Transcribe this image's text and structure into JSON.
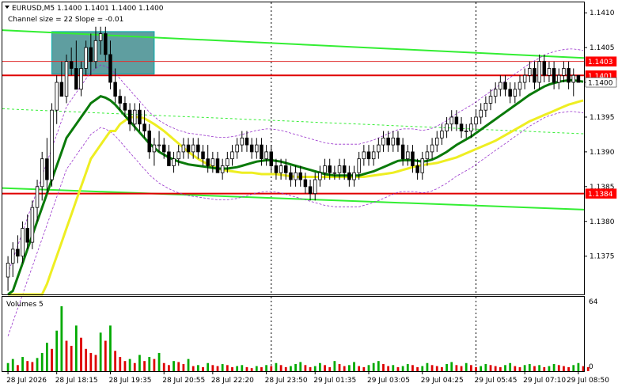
{
  "chart_data": {
    "type": "candlestick",
    "header": {
      "symbol_line": "EURUSD,M5  1.1400 1.1401 1.1400 1.1400",
      "indicator_line": "Channel size = 22  Slope = -0.01"
    },
    "price_axis": {
      "ylim": [
        1.13695,
        1.14115
      ],
      "ticks": [
        "1.1410",
        "1.1405",
        "1.1400",
        "1.1395",
        "1.1390",
        "1.1385",
        "1.1380",
        "1.1375"
      ],
      "tick_values": [
        1.141,
        1.1405,
        1.14,
        1.1395,
        1.139,
        1.1385,
        1.138,
        1.1375
      ]
    },
    "price_boxes": [
      {
        "label": "1.1403",
        "value": 1.1403,
        "color": "#ff0000",
        "text_color": "#ffffff"
      },
      {
        "label": "1.1401",
        "value": 1.1401,
        "color": "#ff0000",
        "text_color": "#ffffff"
      },
      {
        "label": "1.1400",
        "value": 1.14,
        "color": "#ffffff",
        "text_color": "#000000"
      },
      {
        "label": "1.1384",
        "value": 1.1384,
        "color": "#ff0000",
        "text_color": "#ffffff"
      }
    ],
    "horizontal_lines": [
      {
        "value": 1.1403,
        "color": "#e03030",
        "width": 1
      },
      {
        "value": 1.1401,
        "color": "#e00000",
        "width": 2
      },
      {
        "value": 1.1384,
        "color": "#e00000",
        "width": 2
      }
    ],
    "channel": {
      "color": "#33ee33",
      "upper": [
        [
          0,
          1.14075
        ],
        [
          118,
          1.14035
        ]
      ],
      "lower": [
        [
          0,
          1.13848
        ],
        [
          118,
          1.13817
        ]
      ],
      "middle": [
        [
          0,
          1.13962
        ],
        [
          118,
          1.13926
        ]
      ]
    },
    "zone": {
      "from": 9,
      "to": 30,
      "top": 1.14073,
      "bottom": 1.14012,
      "color": "#5f9ea0"
    },
    "dividers": [
      54,
      96
    ],
    "time_axis": {
      "labels": [
        "28 Jul 2026",
        "28 Jul 18:15",
        "28 Jul 19:35",
        "28 Jul 20:55",
        "28 Jul 22:20",
        "28 Jul 23:50",
        "29 Jul 01:35",
        "29 Jul 03:05",
        "29 Jul 04:25",
        "29 Jul 05:45",
        "29 Jul 07:10",
        "29 Jul 08:50"
      ],
      "positions": [
        0,
        10,
        21,
        32,
        42,
        53,
        63,
        74,
        85,
        96,
        106,
        117
      ]
    },
    "candles": [
      [
        1.1372,
        1.1375,
        1.137,
        1.1374
      ],
      [
        1.1374,
        1.1377,
        1.1372,
        1.1376
      ],
      [
        1.1376,
        1.1378,
        1.1374,
        1.1375
      ],
      [
        1.1375,
        1.138,
        1.1374,
        1.1379
      ],
      [
        1.1379,
        1.1381,
        1.1376,
        1.1377
      ],
      [
        1.1377,
        1.1383,
        1.1376,
        1.1382
      ],
      [
        1.1382,
        1.1386,
        1.138,
        1.1385
      ],
      [
        1.1385,
        1.139,
        1.1383,
        1.1389
      ],
      [
        1.1389,
        1.1392,
        1.1384,
        1.1386
      ],
      [
        1.1386,
        1.1397,
        1.1385,
        1.1396
      ],
      [
        1.1396,
        1.1401,
        1.1394,
        1.14
      ],
      [
        1.14,
        1.1403,
        1.1398,
        1.1398
      ],
      [
        1.1398,
        1.1404,
        1.1397,
        1.1403
      ],
      [
        1.1403,
        1.1405,
        1.1401,
        1.1402
      ],
      [
        1.1402,
        1.1406,
        1.14,
        1.1399
      ],
      [
        1.1399,
        1.1403,
        1.1398,
        1.1402
      ],
      [
        1.1402,
        1.1406,
        1.1401,
        1.1405
      ],
      [
        1.1405,
        1.1407,
        1.1401,
        1.1403
      ],
      [
        1.1403,
        1.1408,
        1.1402,
        1.1406
      ],
      [
        1.1406,
        1.1408,
        1.1404,
        1.1407
      ],
      [
        1.1407,
        1.1408,
        1.1403,
        1.1404
      ],
      [
        1.1404,
        1.1406,
        1.1399,
        1.14
      ],
      [
        1.14,
        1.1402,
        1.1397,
        1.1398
      ],
      [
        1.1398,
        1.1399,
        1.1396,
        1.1397
      ],
      [
        1.1397,
        1.1398,
        1.1395,
        1.1396
      ],
      [
        1.1396,
        1.1397,
        1.1393,
        1.1394
      ],
      [
        1.1394,
        1.1397,
        1.1393,
        1.1396
      ],
      [
        1.1396,
        1.1397,
        1.1393,
        1.1394
      ],
      [
        1.1394,
        1.1396,
        1.1392,
        1.1393
      ],
      [
        1.1393,
        1.1394,
        1.1389,
        1.139
      ],
      [
        1.139,
        1.1392,
        1.1388,
        1.1391
      ],
      [
        1.1391,
        1.1393,
        1.139,
        1.1391
      ],
      [
        1.1391,
        1.1392,
        1.1389,
        1.139
      ],
      [
        1.139,
        1.1391,
        1.1388,
        1.1388
      ],
      [
        1.1388,
        1.139,
        1.1387,
        1.1389
      ],
      [
        1.1389,
        1.1391,
        1.1388,
        1.139
      ],
      [
        1.139,
        1.1392,
        1.1389,
        1.1391
      ],
      [
        1.1391,
        1.1392,
        1.1389,
        1.139
      ],
      [
        1.139,
        1.1392,
        1.1389,
        1.1391
      ],
      [
        1.1391,
        1.1392,
        1.1389,
        1.139
      ],
      [
        1.139,
        1.1391,
        1.1388,
        1.1389
      ],
      [
        1.1389,
        1.1391,
        1.1387,
        1.1388
      ],
      [
        1.1388,
        1.139,
        1.1387,
        1.1389
      ],
      [
        1.1389,
        1.139,
        1.1387,
        1.1387
      ],
      [
        1.1387,
        1.1389,
        1.1386,
        1.1388
      ],
      [
        1.1388,
        1.139,
        1.1387,
        1.1389
      ],
      [
        1.1389,
        1.1391,
        1.1388,
        1.139
      ],
      [
        1.139,
        1.1392,
        1.1389,
        1.1391
      ],
      [
        1.1391,
        1.1393,
        1.139,
        1.1392
      ],
      [
        1.1392,
        1.1393,
        1.139,
        1.1391
      ],
      [
        1.1391,
        1.1392,
        1.1389,
        1.139
      ],
      [
        1.139,
        1.1392,
        1.1389,
        1.1391
      ],
      [
        1.1391,
        1.1392,
        1.1388,
        1.1389
      ],
      [
        1.1389,
        1.1391,
        1.1388,
        1.139
      ],
      [
        1.139,
        1.1391,
        1.1387,
        1.1388
      ],
      [
        1.1388,
        1.1389,
        1.1386,
        1.1387
      ],
      [
        1.1387,
        1.1389,
        1.1386,
        1.1388
      ],
      [
        1.1388,
        1.1389,
        1.1386,
        1.1387
      ],
      [
        1.1387,
        1.1388,
        1.1385,
        1.1386
      ],
      [
        1.1386,
        1.1388,
        1.1385,
        1.1387
      ],
      [
        1.1387,
        1.1388,
        1.1385,
        1.1386
      ],
      [
        1.1386,
        1.1387,
        1.1384,
        1.1385
      ],
      [
        1.1385,
        1.1386,
        1.1383,
        1.1384
      ],
      [
        1.1384,
        1.1387,
        1.1383,
        1.1386
      ],
      [
        1.1386,
        1.1388,
        1.1385,
        1.1387
      ],
      [
        1.1387,
        1.1389,
        1.1386,
        1.1388
      ],
      [
        1.1388,
        1.1389,
        1.1386,
        1.1387
      ],
      [
        1.1387,
        1.1388,
        1.1386,
        1.1387
      ],
      [
        1.1387,
        1.1389,
        1.1386,
        1.1388
      ],
      [
        1.1388,
        1.1389,
        1.1386,
        1.1387
      ],
      [
        1.1387,
        1.1388,
        1.1385,
        1.1386
      ],
      [
        1.1386,
        1.1388,
        1.1385,
        1.1387
      ],
      [
        1.1387,
        1.139,
        1.1386,
        1.1389
      ],
      [
        1.1389,
        1.1391,
        1.1388,
        1.139
      ],
      [
        1.139,
        1.1391,
        1.1388,
        1.1389
      ],
      [
        1.1389,
        1.1391,
        1.1388,
        1.139
      ],
      [
        1.139,
        1.1392,
        1.1389,
        1.1391
      ],
      [
        1.1391,
        1.1393,
        1.139,
        1.1392
      ],
      [
        1.1392,
        1.1393,
        1.139,
        1.1391
      ],
      [
        1.1391,
        1.1393,
        1.139,
        1.1392
      ],
      [
        1.1392,
        1.1393,
        1.139,
        1.1391
      ],
      [
        1.1391,
        1.1392,
        1.1388,
        1.1389
      ],
      [
        1.1389,
        1.1391,
        1.1388,
        1.139
      ],
      [
        1.139,
        1.1391,
        1.1387,
        1.1388
      ],
      [
        1.1388,
        1.1389,
        1.1386,
        1.1387
      ],
      [
        1.1387,
        1.139,
        1.1386,
        1.1389
      ],
      [
        1.1389,
        1.1391,
        1.1388,
        1.139
      ],
      [
        1.139,
        1.1392,
        1.1389,
        1.1391
      ],
      [
        1.1391,
        1.1393,
        1.139,
        1.1392
      ],
      [
        1.1392,
        1.1394,
        1.1391,
        1.1393
      ],
      [
        1.1393,
        1.1395,
        1.1392,
        1.1394
      ],
      [
        1.1394,
        1.1396,
        1.1393,
        1.1395
      ],
      [
        1.1395,
        1.1396,
        1.1393,
        1.1394
      ],
      [
        1.1394,
        1.1395,
        1.1392,
        1.1393
      ],
      [
        1.1393,
        1.1394,
        1.1392,
        1.1393
      ],
      [
        1.1393,
        1.1395,
        1.1392,
        1.1394
      ],
      [
        1.1394,
        1.1396,
        1.1393,
        1.1395
      ],
      [
        1.1395,
        1.1397,
        1.1394,
        1.1396
      ],
      [
        1.1396,
        1.1398,
        1.1395,
        1.1397
      ],
      [
        1.1397,
        1.1399,
        1.1396,
        1.1398
      ],
      [
        1.1398,
        1.14,
        1.1397,
        1.1399
      ],
      [
        1.1399,
        1.1401,
        1.1398,
        1.14
      ],
      [
        1.14,
        1.1401,
        1.1398,
        1.1399
      ],
      [
        1.1399,
        1.14,
        1.1397,
        1.1398
      ],
      [
        1.1398,
        1.14,
        1.1397,
        1.1399
      ],
      [
        1.1399,
        1.1401,
        1.1398,
        1.14
      ],
      [
        1.14,
        1.1402,
        1.1399,
        1.1401
      ],
      [
        1.1401,
        1.1403,
        1.14,
        1.1402
      ],
      [
        1.1402,
        1.1403,
        1.1399,
        1.14
      ],
      [
        1.14,
        1.1404,
        1.1399,
        1.1403
      ],
      [
        1.1403,
        1.1404,
        1.14,
        1.1401
      ],
      [
        1.1401,
        1.1403,
        1.14,
        1.1402
      ],
      [
        1.1402,
        1.1403,
        1.1399,
        1.14
      ],
      [
        1.14,
        1.1402,
        1.1399,
        1.1401
      ],
      [
        1.1401,
        1.1403,
        1.14,
        1.1402
      ],
      [
        1.1402,
        1.1403,
        1.1399,
        1.14
      ],
      [
        1.14,
        1.1402,
        1.1398,
        1.1401
      ],
      [
        1.1401,
        1.1401,
        1.14,
        1.14
      ]
    ],
    "ma_fast": {
      "name": "",
      "color": "#0a7a0a",
      "values": [
        1.1368,
        1.137,
        1.1372,
        1.1374,
        1.1376,
        1.1378,
        1.138,
        1.1382,
        1.1384,
        1.1386,
        1.1388,
        1.139,
        1.1392,
        1.1393,
        1.1394,
        1.1395,
        1.1396,
        1.1397,
        1.13975,
        1.1398,
        1.13978,
        1.13974,
        1.13968,
        1.1396,
        1.13952,
        1.13944,
        1.13936,
        1.13928,
        1.1392,
        1.13912,
        1.13906,
        1.139,
        1.13896,
        1.13892,
        1.13889,
        1.13886,
        1.13884,
        1.13882,
        1.13881,
        1.1388,
        1.13879,
        1.13878,
        1.13877,
        1.13876,
        1.13876,
        1.13876,
        1.13877,
        1.13878,
        1.1388,
        1.13882,
        1.13884,
        1.13886,
        1.13887,
        1.13888,
        1.13888,
        1.13887,
        1.13886,
        1.13884,
        1.13882,
        1.1388,
        1.13878,
        1.13876,
        1.13874,
        1.13872,
        1.1387,
        1.13868,
        1.13867,
        1.13866,
        1.13866,
        1.13866,
        1.13866,
        1.13866,
        1.13866,
        1.13868,
        1.1387,
        1.13872,
        1.13875,
        1.13878,
        1.13881,
        1.13884,
        1.13887,
        1.13888,
        1.13888,
        1.13888,
        1.13887,
        1.13886,
        1.13887,
        1.13889,
        1.13892,
        1.13896,
        1.139,
        1.13905,
        1.1391,
        1.13914,
        1.13918,
        1.13922,
        1.13927,
        1.13932,
        1.13937,
        1.13942,
        1.13947,
        1.13952,
        1.13957,
        1.13962,
        1.13967,
        1.13972,
        1.13977,
        1.13982,
        1.13986,
        1.1399,
        1.13994,
        1.13997,
        1.13999,
        1.14001,
        1.14002,
        1.14003,
        1.14003,
        1.14002,
        1.14001
      ]
    },
    "ma_slow": {
      "name": "",
      "color": "#eeee22",
      "values": [
        1.1355,
        1.1357,
        1.1359,
        1.1361,
        1.1363,
        1.1365,
        1.1367,
        1.1369,
        1.1371,
        1.1373,
        1.1375,
        1.1377,
        1.1379,
        1.1381,
        1.1383,
        1.1385,
        1.1387,
        1.1389,
        1.139,
        1.1391,
        1.1392,
        1.1393,
        1.1393,
        1.1394,
        1.13945,
        1.1395,
        1.1395,
        1.1395,
        1.13948,
        1.13944,
        1.1394,
        1.13935,
        1.1393,
        1.13924,
        1.13918,
        1.13912,
        1.13906,
        1.139,
        1.13895,
        1.1389,
        1.13886,
        1.13882,
        1.13879,
        1.13876,
        1.13874,
        1.13873,
        1.13872,
        1.13871,
        1.1387,
        1.1387,
        1.1387,
        1.13869,
        1.13868,
        1.13868,
        1.13868,
        1.13868,
        1.13867,
        1.13866,
        1.13865,
        1.13864,
        1.13864,
        1.13864,
        1.13864,
        1.13864,
        1.13864,
        1.13864,
        1.13864,
        1.13864,
        1.13864,
        1.13864,
        1.13864,
        1.13864,
        1.13864,
        1.13864,
        1.13865,
        1.13866,
        1.13867,
        1.13868,
        1.13869,
        1.1387,
        1.13872,
        1.13874,
        1.13876,
        1.13878,
        1.1388,
        1.13881,
        1.13882,
        1.13883,
        1.13884,
        1.13886,
        1.13888,
        1.1389,
        1.13892,
        1.13895,
        1.13898,
        1.13901,
        1.13904,
        1.13907,
        1.1391,
        1.13913,
        1.13916,
        1.1392,
        1.13924,
        1.13928,
        1.13932,
        1.13936,
        1.1394,
        1.13944,
        1.13947,
        1.1395,
        1.13953,
        1.13956,
        1.13959,
        1.13962,
        1.13965,
        1.13968,
        1.1397,
        1.13972,
        1.13974
      ]
    },
    "volume": {
      "label": "Volumes 5",
      "axis_ticks": [
        "64",
        "0"
      ],
      "ymax": 64,
      "values": [
        8,
        12,
        6,
        14,
        10,
        9,
        13,
        18,
        28,
        22,
        40,
        64,
        30,
        25,
        45,
        33,
        22,
        18,
        16,
        38,
        30,
        45,
        20,
        14,
        10,
        12,
        8,
        16,
        10,
        14,
        12,
        18,
        8,
        6,
        10,
        9,
        7,
        12,
        5,
        6,
        4,
        8,
        6,
        5,
        7,
        6,
        4,
        5,
        6,
        4,
        3,
        5,
        4,
        6,
        5,
        8,
        6,
        4,
        5,
        7,
        9,
        6,
        4,
        5,
        8,
        6,
        4,
        10,
        7,
        5,
        6,
        9,
        5,
        4,
        6,
        8,
        10,
        7,
        5,
        6,
        4,
        5,
        7,
        6,
        4,
        5,
        8,
        6,
        5,
        4,
        7,
        9,
        6,
        5,
        8,
        6,
        4,
        5,
        7,
        6,
        5,
        4,
        6,
        8,
        5,
        4,
        6,
        7,
        5,
        6,
        4,
        5,
        7,
        6,
        5,
        4,
        6,
        8,
        5,
        4
      ]
    }
  }
}
